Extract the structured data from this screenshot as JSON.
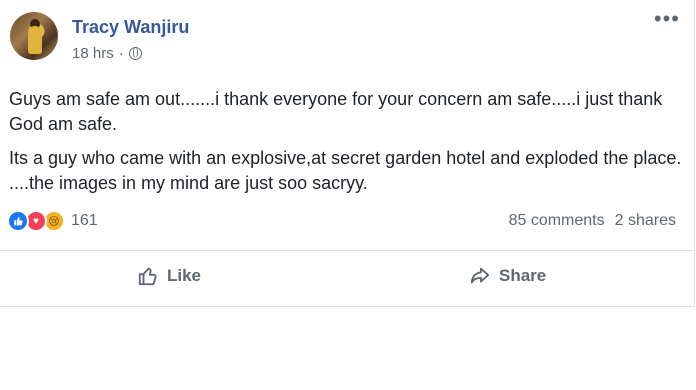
{
  "post": {
    "author": "Tracy Wanjiru",
    "timestamp": "18 hrs",
    "separator": "·",
    "privacy_icon": "globe-icon",
    "more_icon": "ellipsis-icon",
    "more_label": "•••",
    "paragraphs": [
      "Guys am safe am out.......i thank everyone for your concern am safe.....i just thank God am safe.",
      "Its a guy who came with an explosive,at secret garden hotel and exploded the place. ....the images in my mind are just soo sacryy."
    ]
  },
  "reactions": {
    "types": [
      "like",
      "love",
      "sad"
    ],
    "like_glyph": "👍",
    "love_glyph": "♥",
    "sad_glyph": "😢",
    "count": "161"
  },
  "stats": {
    "comments": "85 comments",
    "shares": "2 shares"
  },
  "actions": {
    "like_label": "Like",
    "share_label": "Share"
  },
  "colors": {
    "author": "#385898",
    "secondary_text": "#616770",
    "like_blue": "#1877f2",
    "love_red": "#f33e58",
    "sad_yellow": "#f7b125"
  }
}
